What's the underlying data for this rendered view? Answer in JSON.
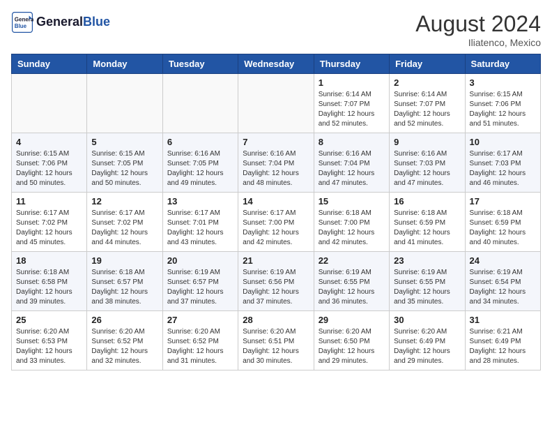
{
  "header": {
    "logo_general": "General",
    "logo_blue": "Blue",
    "month_year": "August 2024",
    "location": "Iliatenco, Mexico"
  },
  "weekdays": [
    "Sunday",
    "Monday",
    "Tuesday",
    "Wednesday",
    "Thursday",
    "Friday",
    "Saturday"
  ],
  "weeks": [
    [
      {
        "day": "",
        "info": ""
      },
      {
        "day": "",
        "info": ""
      },
      {
        "day": "",
        "info": ""
      },
      {
        "day": "",
        "info": ""
      },
      {
        "day": "1",
        "info": "Sunrise: 6:14 AM\nSunset: 7:07 PM\nDaylight: 12 hours\nand 52 minutes."
      },
      {
        "day": "2",
        "info": "Sunrise: 6:14 AM\nSunset: 7:07 PM\nDaylight: 12 hours\nand 52 minutes."
      },
      {
        "day": "3",
        "info": "Sunrise: 6:15 AM\nSunset: 7:06 PM\nDaylight: 12 hours\nand 51 minutes."
      }
    ],
    [
      {
        "day": "4",
        "info": "Sunrise: 6:15 AM\nSunset: 7:06 PM\nDaylight: 12 hours\nand 50 minutes."
      },
      {
        "day": "5",
        "info": "Sunrise: 6:15 AM\nSunset: 7:05 PM\nDaylight: 12 hours\nand 50 minutes."
      },
      {
        "day": "6",
        "info": "Sunrise: 6:16 AM\nSunset: 7:05 PM\nDaylight: 12 hours\nand 49 minutes."
      },
      {
        "day": "7",
        "info": "Sunrise: 6:16 AM\nSunset: 7:04 PM\nDaylight: 12 hours\nand 48 minutes."
      },
      {
        "day": "8",
        "info": "Sunrise: 6:16 AM\nSunset: 7:04 PM\nDaylight: 12 hours\nand 47 minutes."
      },
      {
        "day": "9",
        "info": "Sunrise: 6:16 AM\nSunset: 7:03 PM\nDaylight: 12 hours\nand 47 minutes."
      },
      {
        "day": "10",
        "info": "Sunrise: 6:17 AM\nSunset: 7:03 PM\nDaylight: 12 hours\nand 46 minutes."
      }
    ],
    [
      {
        "day": "11",
        "info": "Sunrise: 6:17 AM\nSunset: 7:02 PM\nDaylight: 12 hours\nand 45 minutes."
      },
      {
        "day": "12",
        "info": "Sunrise: 6:17 AM\nSunset: 7:02 PM\nDaylight: 12 hours\nand 44 minutes."
      },
      {
        "day": "13",
        "info": "Sunrise: 6:17 AM\nSunset: 7:01 PM\nDaylight: 12 hours\nand 43 minutes."
      },
      {
        "day": "14",
        "info": "Sunrise: 6:17 AM\nSunset: 7:00 PM\nDaylight: 12 hours\nand 42 minutes."
      },
      {
        "day": "15",
        "info": "Sunrise: 6:18 AM\nSunset: 7:00 PM\nDaylight: 12 hours\nand 42 minutes."
      },
      {
        "day": "16",
        "info": "Sunrise: 6:18 AM\nSunset: 6:59 PM\nDaylight: 12 hours\nand 41 minutes."
      },
      {
        "day": "17",
        "info": "Sunrise: 6:18 AM\nSunset: 6:59 PM\nDaylight: 12 hours\nand 40 minutes."
      }
    ],
    [
      {
        "day": "18",
        "info": "Sunrise: 6:18 AM\nSunset: 6:58 PM\nDaylight: 12 hours\nand 39 minutes."
      },
      {
        "day": "19",
        "info": "Sunrise: 6:18 AM\nSunset: 6:57 PM\nDaylight: 12 hours\nand 38 minutes."
      },
      {
        "day": "20",
        "info": "Sunrise: 6:19 AM\nSunset: 6:57 PM\nDaylight: 12 hours\nand 37 minutes."
      },
      {
        "day": "21",
        "info": "Sunrise: 6:19 AM\nSunset: 6:56 PM\nDaylight: 12 hours\nand 37 minutes."
      },
      {
        "day": "22",
        "info": "Sunrise: 6:19 AM\nSunset: 6:55 PM\nDaylight: 12 hours\nand 36 minutes."
      },
      {
        "day": "23",
        "info": "Sunrise: 6:19 AM\nSunset: 6:55 PM\nDaylight: 12 hours\nand 35 minutes."
      },
      {
        "day": "24",
        "info": "Sunrise: 6:19 AM\nSunset: 6:54 PM\nDaylight: 12 hours\nand 34 minutes."
      }
    ],
    [
      {
        "day": "25",
        "info": "Sunrise: 6:20 AM\nSunset: 6:53 PM\nDaylight: 12 hours\nand 33 minutes."
      },
      {
        "day": "26",
        "info": "Sunrise: 6:20 AM\nSunset: 6:52 PM\nDaylight: 12 hours\nand 32 minutes."
      },
      {
        "day": "27",
        "info": "Sunrise: 6:20 AM\nSunset: 6:52 PM\nDaylight: 12 hours\nand 31 minutes."
      },
      {
        "day": "28",
        "info": "Sunrise: 6:20 AM\nSunset: 6:51 PM\nDaylight: 12 hours\nand 30 minutes."
      },
      {
        "day": "29",
        "info": "Sunrise: 6:20 AM\nSunset: 6:50 PM\nDaylight: 12 hours\nand 29 minutes."
      },
      {
        "day": "30",
        "info": "Sunrise: 6:20 AM\nSunset: 6:49 PM\nDaylight: 12 hours\nand 29 minutes."
      },
      {
        "day": "31",
        "info": "Sunrise: 6:21 AM\nSunset: 6:49 PM\nDaylight: 12 hours\nand 28 minutes."
      }
    ]
  ]
}
